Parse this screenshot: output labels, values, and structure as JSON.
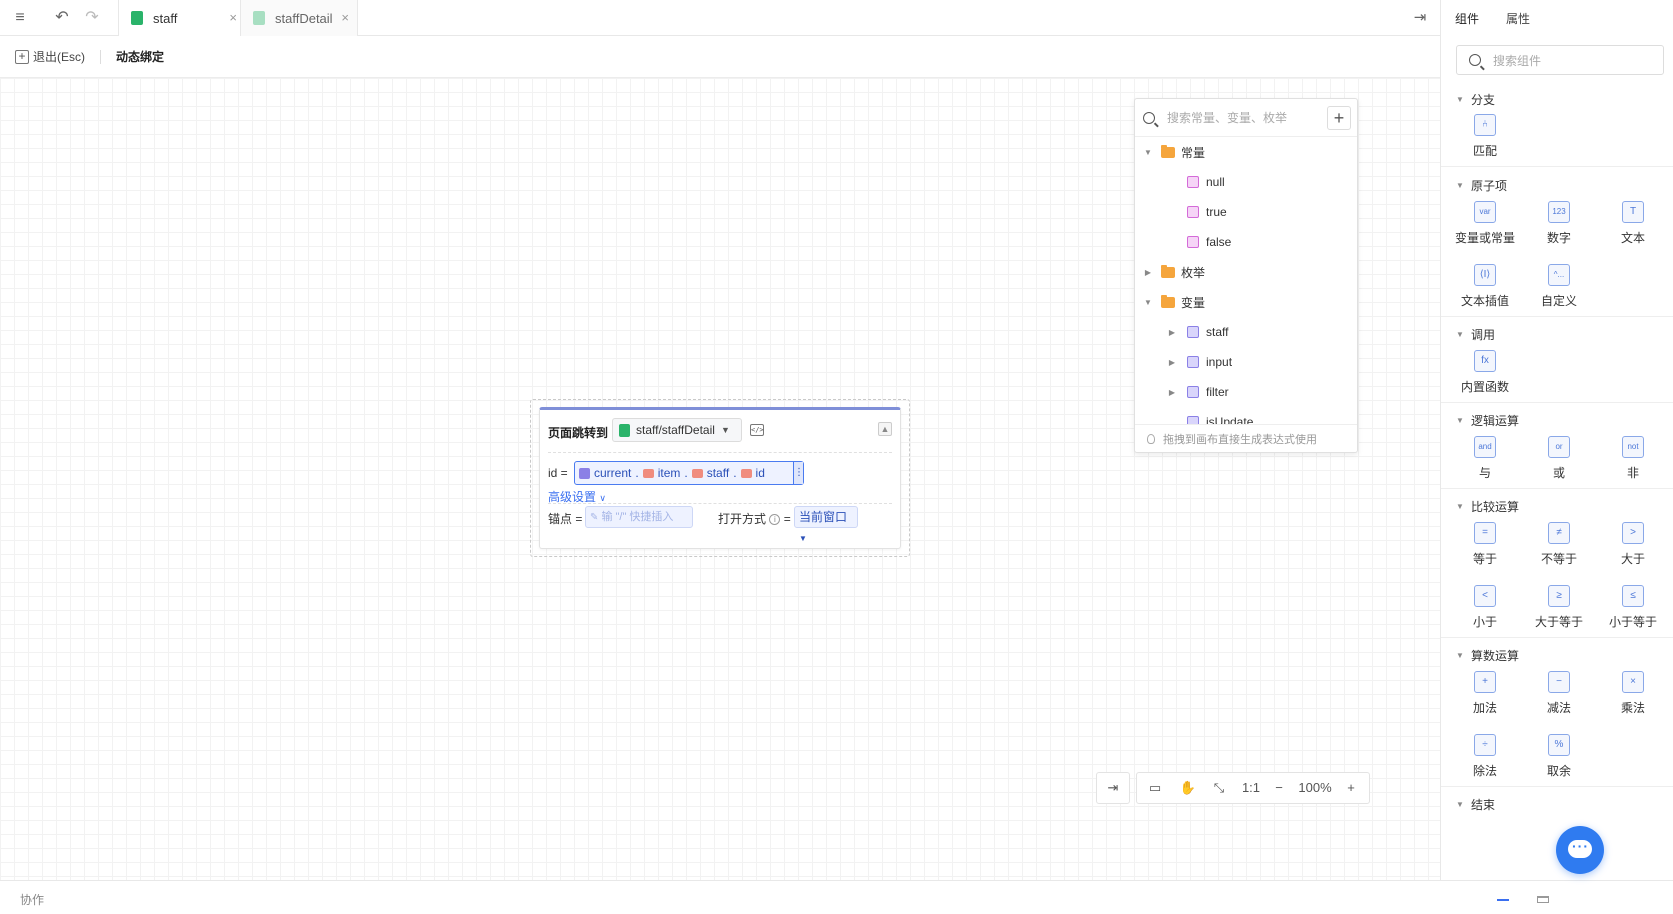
{
  "tabs": [
    {
      "label": "staff",
      "active": true
    },
    {
      "label": "staffDetail",
      "active": false
    }
  ],
  "toolbar": {
    "exit_label": "退出(Esc)",
    "title": "动态绑定"
  },
  "node": {
    "title": "页面跳转到",
    "page": "staff/staffDetail",
    "id_label": "id =",
    "expr": [
      "current",
      "item",
      "staff",
      "id"
    ],
    "advanced": "高级设置",
    "anchor_label": "锚点 =",
    "anchor_placeholder": "输 \"/\" 快捷插入",
    "open_label": "打开方式",
    "open_eq": "=",
    "open_value": "当前窗口"
  },
  "picker": {
    "search_placeholder": "搜索常量、变量、枚举",
    "tree": {
      "constants": "常量",
      "constant_items": [
        "null",
        "true",
        "false"
      ],
      "enums": "枚举",
      "variables": "变量",
      "variable_items": [
        "staff",
        "input",
        "filter",
        "isUpdate"
      ]
    },
    "footer": "拖拽到画布直接生成表达式使用"
  },
  "zoom": {
    "ratio": "1:1",
    "percent": "100%"
  },
  "bottom": {
    "collab": "协作"
  },
  "panel": {
    "tabs": [
      "组件",
      "属性"
    ],
    "search_placeholder": "搜索组件",
    "sections": {
      "branch": "分支",
      "atom": "原子项",
      "call": "调用",
      "logic": "逻辑运算",
      "compare": "比较运算",
      "arith": "算数运算",
      "end": "结束"
    },
    "items": {
      "match": "匹配",
      "var_const": "变量或常量",
      "number": "数字",
      "text": "文本",
      "text_interp": "文本插值",
      "custom": "自定义",
      "builtin": "内置函数",
      "and": "与",
      "or": "或",
      "not": "非",
      "eq": "等于",
      "neq": "不等于",
      "gt": "大于",
      "lt": "小于",
      "gte": "大于等于",
      "lte": "小于等于",
      "add": "加法",
      "sub": "减法",
      "mul": "乘法",
      "div": "除法",
      "mod": "取余"
    },
    "icons": {
      "var_const": "var",
      "number": "123",
      "text": "T",
      "custom": "^...",
      "builtin": "fx",
      "and": "and",
      "or": "or",
      "not": "not",
      "eq": "=",
      "neq": "≠",
      "gt": ">",
      "lt": "<",
      "gte": "≥",
      "lte": "≤",
      "add": "+",
      "sub": "−",
      "mul": "×",
      "div": "÷",
      "mod": "%"
    }
  }
}
